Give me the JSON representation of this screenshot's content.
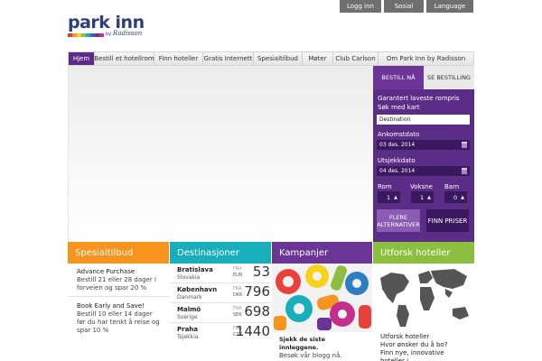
{
  "brand": {
    "name": "park inn",
    "by": "by",
    "radisson": "Radisson"
  },
  "topbar": {
    "login": "Logg inn",
    "social": "Sosial",
    "language": "Language"
  },
  "nav": {
    "items": [
      "Hjem",
      "Bestill et hotellrom",
      "Finn hoteller",
      "Gratis Internett",
      "Spesialtilbud",
      "Møter",
      "Club Carlson",
      "Om Park Inn by Radisson"
    ],
    "active": "Hjem"
  },
  "booking": {
    "tab_book": "BESTILL NÅ",
    "tab_view": "SE BESTILLING",
    "guarantee": "Garantert laveste rompris",
    "map_search": "Søk med kart",
    "destination_value": "Destination",
    "arrival_label": "Ankomstdato",
    "arrival_value": "03 des. 2014",
    "departure_label": "Utsjekkdato",
    "departure_value": "04 des. 2014",
    "rooms_label": "Rom",
    "rooms_value": "1",
    "adults_label": "Voksne",
    "adults_value": "1",
    "children_label": "Barn",
    "children_value": "0",
    "more_options": "FLERE ALTERNATIVER",
    "find_prices": "FINN PRISER"
  },
  "tiles": {
    "offers": {
      "title": "Spesialtilbud",
      "items": [
        {
          "title": "Advance Purchase",
          "desc": "Bestill 21 eller 28 dager i forveien og spar 20 %"
        },
        {
          "title": "Book Early and Save!",
          "desc": "Bestill 10 eller 14 dager før du har tenkt å reise og spar 10 %"
        }
      ]
    },
    "destinations": {
      "title": "Destinasjoner",
      "fra": "FRA",
      "items": [
        {
          "city": "Bratislava",
          "country": "Slovakia",
          "currency": "EUR",
          "price": "53"
        },
        {
          "city": "København",
          "country": "Danmark",
          "currency": "DKK",
          "price": "796"
        },
        {
          "city": "Malmö",
          "country": "Sverige",
          "currency": "SEK",
          "price": "698"
        },
        {
          "city": "Praha",
          "country": "Tsjekkia",
          "currency": "CZK",
          "price": "1440"
        }
      ]
    },
    "campaigns": {
      "title": "Kampanjer",
      "headline": "Sjekk de siste innleggene.",
      "text": "Besøk vår blogg nå."
    },
    "explore": {
      "title": "Utforsk hoteller",
      "line1": "Utforsk hoteller",
      "line2": "Hvor ønsker du å bo?",
      "line3": "Finn nye, innovative hoteller i"
    }
  },
  "colors": {
    "brand_purple": "#5b2d86",
    "offers": "#f7941d",
    "destinations": "#19aebc",
    "campaigns": "#6a3597",
    "explore": "#8cbf3f"
  }
}
